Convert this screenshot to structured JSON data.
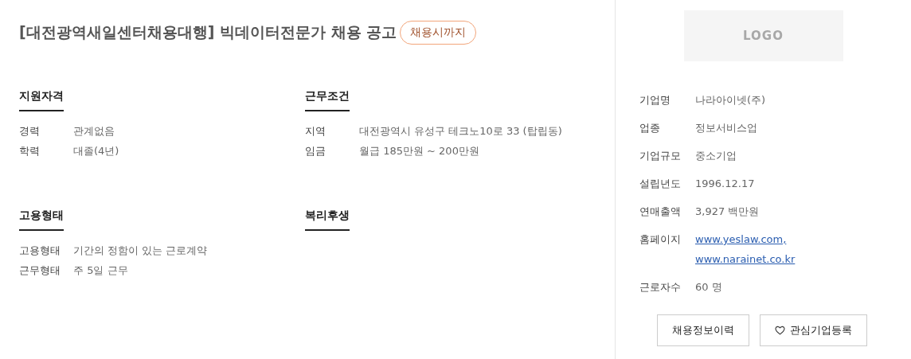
{
  "title": "[대전광역새일센터채용대행] 빅데이터전문가 채용 공고",
  "deadline_badge": "채용시까지",
  "sections": [
    {
      "heading": "지원자격",
      "rows": [
        {
          "label": "경력",
          "value": "관계없음"
        },
        {
          "label": "학력",
          "value": "대졸(4년)"
        }
      ]
    },
    {
      "heading": "근무조건",
      "rows": [
        {
          "label": "지역",
          "value": "대전광역시 유성구 테크노10로 33 (탑립동)"
        },
        {
          "label": "임금",
          "value": "월급 185만원 ~ 200만원"
        }
      ]
    },
    {
      "heading": "고용형태",
      "rows": [
        {
          "label": "고용형태",
          "value": "기간의 정함이 있는 근로계약"
        },
        {
          "label": "근무형태",
          "value": "주 5일 근무"
        }
      ]
    },
    {
      "heading": "복리후생"
    }
  ],
  "company": {
    "logo_text": "LOGO",
    "info": [
      {
        "label": "기업명",
        "kind": "text",
        "values": [
          "나라아이넷(주)"
        ]
      },
      {
        "label": "업종",
        "kind": "text",
        "values": [
          "정보서비스업"
        ]
      },
      {
        "label": "기업규모",
        "kind": "text",
        "values": [
          "중소기업"
        ]
      },
      {
        "label": "설립년도",
        "kind": "text",
        "values": [
          "1996.12.17"
        ]
      },
      {
        "label": "연매출액",
        "kind": "text",
        "values": [
          "3,927 백만원"
        ]
      },
      {
        "label": "홈페이지",
        "kind": "links",
        "values": [
          "www.yeslaw.com,",
          "www.narainet.co.kr"
        ]
      },
      {
        "label": "근로자수",
        "kind": "text",
        "values": [
          "60 명"
        ]
      }
    ],
    "buttons": [
      "채용정보이력",
      "관심기업등록"
    ]
  }
}
